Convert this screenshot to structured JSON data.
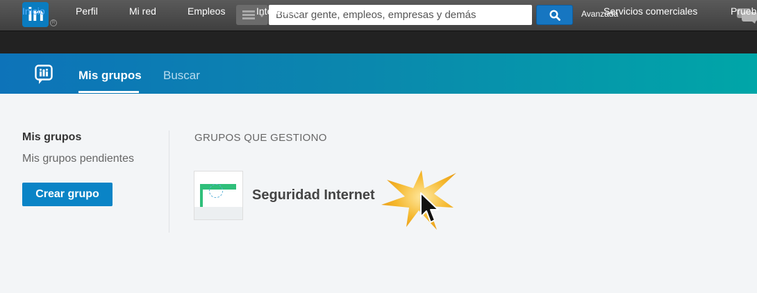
{
  "topbar": {
    "logo_text": "in",
    "search_placeholder": "Buscar gente, empleos, empresas y demás",
    "advanced_label": "Avanzada"
  },
  "nav": {
    "items": [
      {
        "label": "Inicio",
        "active": true
      },
      {
        "label": "Perfil"
      },
      {
        "label": "Mi red"
      },
      {
        "label": "Empleos"
      },
      {
        "label": "Intereses"
      },
      {
        "label": "Servicios comerciales"
      },
      {
        "label": "Pruebl"
      }
    ]
  },
  "groups_header": {
    "tabs": [
      {
        "label": "Mis grupos",
        "active": true
      },
      {
        "label": "Buscar"
      }
    ]
  },
  "sidebar": {
    "title": "Mis grupos",
    "pending_link": "Mis grupos pendientes",
    "create_button": "Crear grupo"
  },
  "main": {
    "section_title": "GRUPOS QUE GESTIONO",
    "groups": [
      {
        "name": "Seguridad Internet"
      }
    ]
  },
  "colors": {
    "brand": "#0a7cc0",
    "active_nav": "#5cb1ff",
    "create_button": "#0a84c6",
    "highlight_burst": "#f5b82e"
  }
}
